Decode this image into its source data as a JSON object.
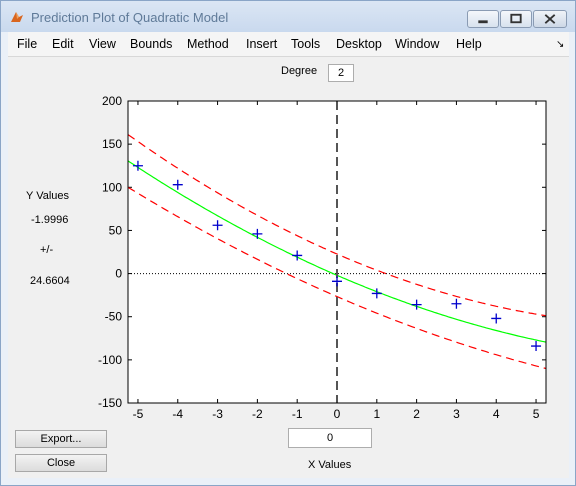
{
  "window": {
    "title": "Prediction Plot of Quadratic Model"
  },
  "menu": [
    "File",
    "Edit",
    "View",
    "Bounds",
    "Method",
    "Insert",
    "Tools",
    "Desktop",
    "Window",
    "Help"
  ],
  "degree": {
    "label": "Degree",
    "value": "2"
  },
  "y_panel": {
    "title": "Y Values",
    "prediction": "-1.9996",
    "pm": "+/-",
    "bound": "24.6604"
  },
  "x_panel": {
    "value": "0",
    "label": "X Values"
  },
  "buttons": {
    "export": "Export...",
    "close": "Close"
  },
  "colors": {
    "fit": "#00ff00",
    "bounds": "#ff0000",
    "points": "#0000cc",
    "crosshair": "#555555"
  },
  "chart_data": {
    "type": "scatter",
    "xlim": [
      -5.25,
      5.25
    ],
    "ylim": [
      -150,
      200
    ],
    "xticks": [
      -5,
      -4,
      -3,
      -2,
      -1,
      0,
      1,
      2,
      3,
      4,
      5
    ],
    "yticks": [
      -150,
      -100,
      -50,
      0,
      50,
      100,
      150,
      200
    ],
    "points": {
      "x": [
        -5,
        -4,
        -3,
        -2,
        -1,
        0,
        1,
        2,
        3,
        4,
        5
      ],
      "y": [
        125,
        103,
        56,
        46,
        21,
        -9,
        -23,
        -36,
        -35,
        -52,
        -84
      ]
    },
    "fit": {
      "a": 1.0,
      "b": -20.0,
      "c": -2.0
    },
    "bounds_halfwidth": {
      "at_center": 24.66,
      "at_edge": 30.0
    },
    "crosshair": {
      "x": 0,
      "y": -1.9996
    }
  }
}
